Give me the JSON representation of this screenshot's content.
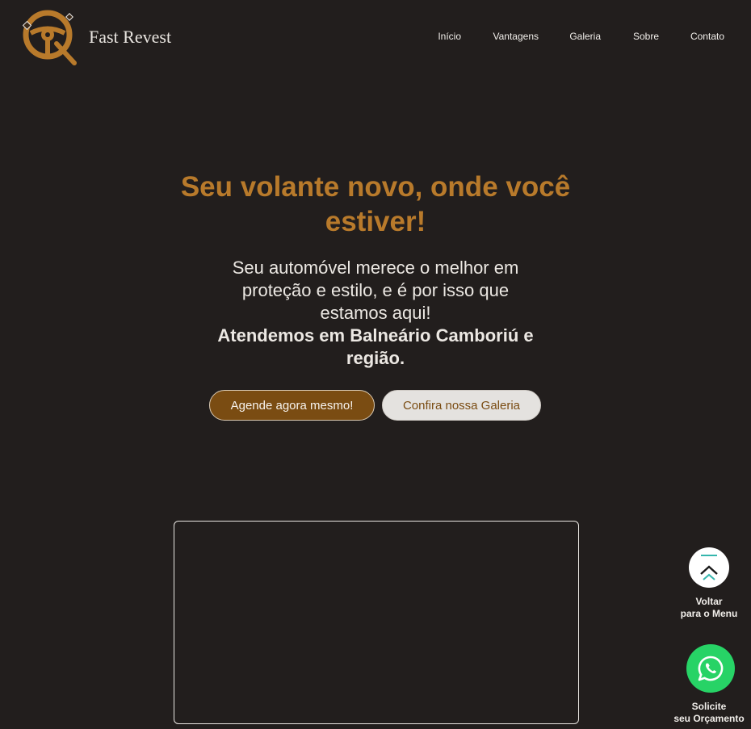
{
  "header": {
    "brand": "Fast Revest",
    "nav": [
      {
        "label": "Início"
      },
      {
        "label": "Vantagens"
      },
      {
        "label": "Galeria"
      },
      {
        "label": "Sobre"
      },
      {
        "label": "Contato"
      }
    ]
  },
  "hero": {
    "title_line1": "Seu volante novo, onde você",
    "title_line2": "estiver!",
    "subtitle_line1": "Seu automóvel merece o melhor em",
    "subtitle_line2": "proteção e estilo, e é por isso que",
    "subtitle_line3": "estamos aqui!",
    "highlight_line1": "Atendemos em Balneário Camboriú e",
    "highlight_line2": "região.",
    "primary_button": "Agende agora mesmo!",
    "secondary_button": "Confira nossa Galeria"
  },
  "floating": {
    "back_line1": "Voltar",
    "back_line2": "para o Menu",
    "whatsapp_line1": "Solicite",
    "whatsapp_line2": "seu Orçamento",
    "back_icon": "chevron-up-icon",
    "whatsapp_icon": "whatsapp-icon"
  },
  "colors": {
    "background": "#221e1d",
    "accent": "#b87a2b",
    "primary_button": "#7a4c12",
    "whatsapp": "#27d366"
  }
}
